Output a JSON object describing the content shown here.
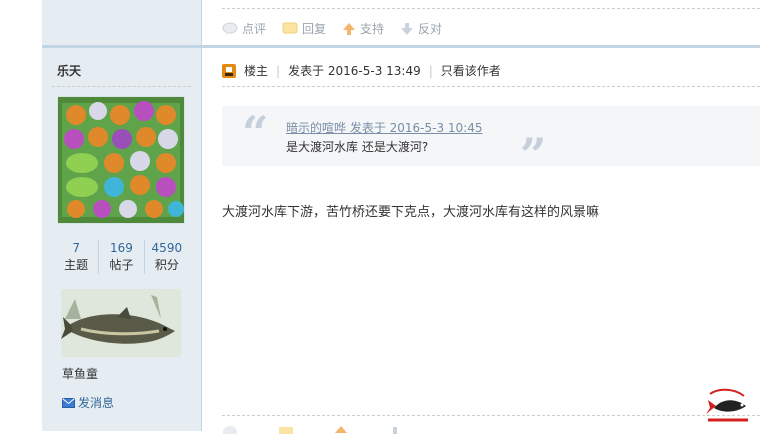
{
  "post_actions": {
    "comment_label": "点评",
    "reply_label": "回复",
    "support_label": "支持",
    "oppose_label": "反对"
  },
  "author": {
    "username": "乐天",
    "stats": [
      {
        "value": "7",
        "label": "主题"
      },
      {
        "value": "169",
        "label": "帖子"
      },
      {
        "value": "4590",
        "label": "积分"
      }
    ],
    "rank_title": "草鱼童",
    "send_message_label": "发消息"
  },
  "post_header": {
    "op_label": "楼主",
    "posted_at": "发表于 2016-5-3 13:49",
    "author_only_label": "只看该作者"
  },
  "quote": {
    "meta": "暗示的喧哗 发表于 2016-5-3 10:45",
    "text": "是大渡河水库 还是大渡河?"
  },
  "body": {
    "text": "大渡河水库下游，苦竹桥还要下克点，大渡河水库有这样的风景嘛"
  },
  "colors": {
    "sidebar_bg": "#e5edf2",
    "separator": "#c2d5e3",
    "link_blue": "#336699",
    "quote_bg": "#f4f6f8"
  }
}
